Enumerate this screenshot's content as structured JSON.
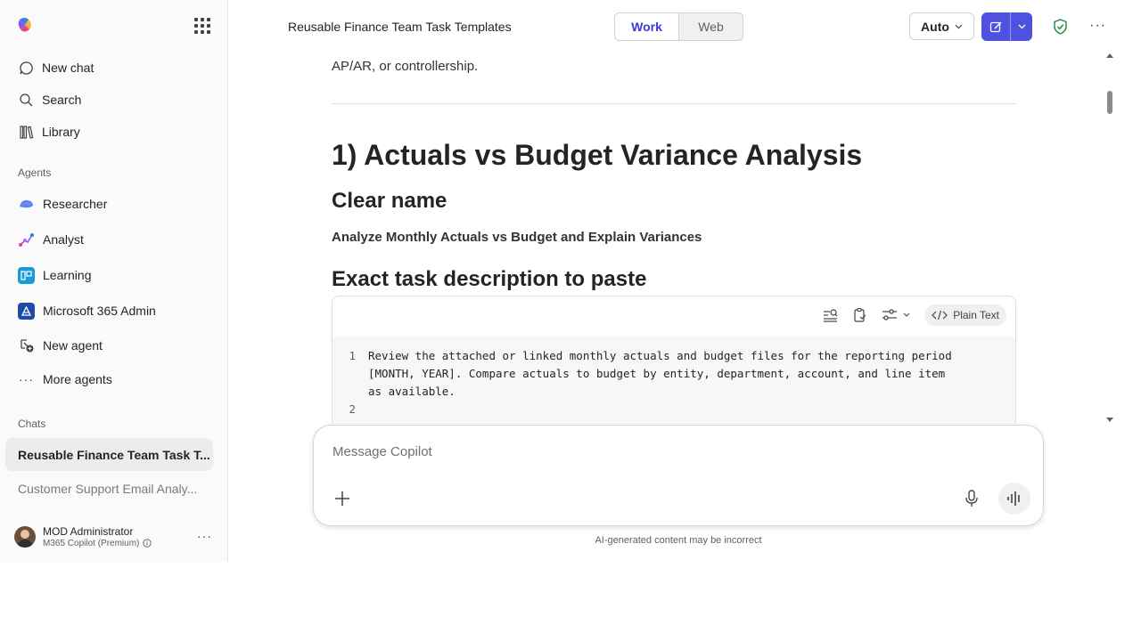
{
  "header": {
    "title": "Reusable Finance Team Task Templates",
    "mode_tabs": [
      "Work",
      "Web"
    ],
    "auto_label": "Auto"
  },
  "sidebar": {
    "nav": [
      {
        "label": "New chat",
        "icon": "new-chat-icon"
      },
      {
        "label": "Search",
        "icon": "search-icon"
      },
      {
        "label": "Library",
        "icon": "library-icon"
      }
    ],
    "agents_label": "Agents",
    "agents": [
      {
        "label": "Researcher",
        "icon": "researcher-icon"
      },
      {
        "label": "Analyst",
        "icon": "analyst-icon"
      },
      {
        "label": "Learning",
        "icon": "learning-icon"
      },
      {
        "label": "Microsoft 365 Admin",
        "icon": "admin-icon"
      },
      {
        "label": "New agent",
        "icon": "new-agent-icon"
      },
      {
        "label": "More agents",
        "icon": "more-icon"
      }
    ],
    "chats_label": "Chats",
    "chats": [
      {
        "label": "Reusable Finance Team Task T...",
        "active": true
      },
      {
        "label": "Customer Support Email Analy...",
        "active": false
      }
    ],
    "user": {
      "name": "MOD Administrator",
      "plan": "M365 Copilot (Premium)"
    }
  },
  "content": {
    "intro_tail": "AP/AR, or controllership.",
    "heading": "1) Actuals vs Budget Variance Analysis",
    "clear_name_heading": "Clear name",
    "clear_name_value": "Analyze Monthly Actuals vs Budget and Explain Variances",
    "task_desc_heading": "Exact task description to paste",
    "code_format_label": "Plain Text",
    "code_lines": [
      {
        "n": "1",
        "text": "Review the attached or linked monthly actuals and budget files for the reporting period\n[MONTH, YEAR]. Compare actuals to budget by entity, department, account, and line item\nas available."
      },
      {
        "n": "2",
        "text": ""
      }
    ]
  },
  "composer": {
    "placeholder": "Message Copilot",
    "disclaimer": "AI-generated content may be incorrect"
  },
  "colors": {
    "accent": "#4f52e0",
    "active_tab_text": "#3a3ad8",
    "shield": "#1e8a3c"
  }
}
